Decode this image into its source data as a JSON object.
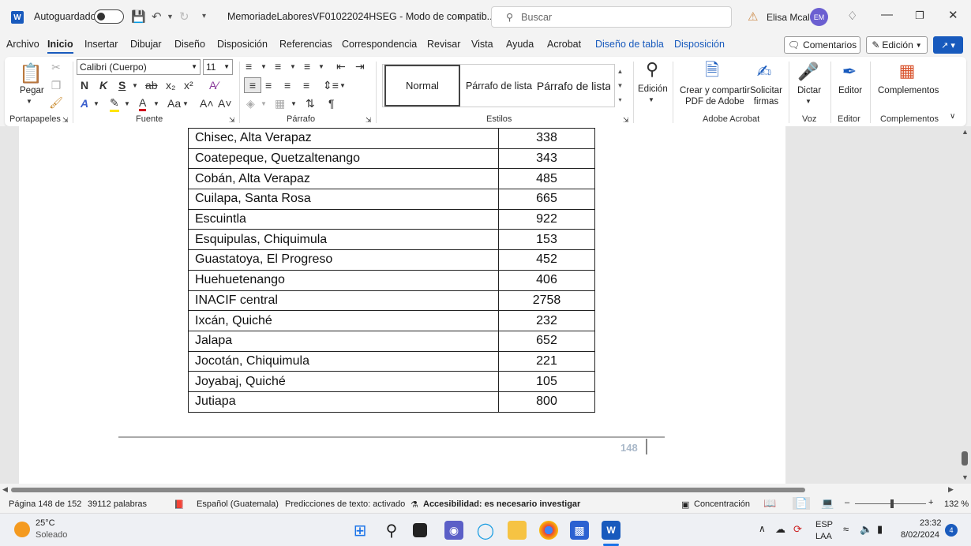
{
  "titlebar": {
    "autosave_label": "Autoguardado",
    "doc_title": "MemoriadeLaboresVF01022024HSEG  -  Modo de compatib...",
    "search_placeholder": "Buscar",
    "user_name": "Elisa Mcal",
    "user_initials": "EM"
  },
  "tabs": [
    "Archivo",
    "Inicio",
    "Insertar",
    "Dibujar",
    "Diseño",
    "Disposición",
    "Referencias",
    "Correspondencia",
    "Revisar",
    "Vista",
    "Ayuda",
    "Acrobat",
    "Diseño de tabla",
    "Disposición"
  ],
  "tab_actions": {
    "comments": "Comentarios",
    "editing": "Edición"
  },
  "ribbon": {
    "clipboard": {
      "paste": "Pegar",
      "label": "Portapapeles"
    },
    "font": {
      "family": "Calibri (Cuerpo)",
      "size": "11",
      "label": "Fuente",
      "bold": "N",
      "italic": "K",
      "underline": "S",
      "strike": "ab",
      "sub": "x₂",
      "sup": "x²",
      "case": "Aa"
    },
    "paragraph": {
      "label": "Párrafo"
    },
    "styles": {
      "label": "Estilos",
      "items": [
        "Normal",
        "Párrafo de lista",
        "Párrafo de lista"
      ]
    },
    "editing": {
      "label": "Edición"
    },
    "acrobat": {
      "create_share": "Crear y compartir\nPDF de Adobe",
      "request_sign": "Solicitar\nfirmas",
      "label": "Adobe Acrobat"
    },
    "voice": {
      "dictate": "Dictar",
      "label": "Voz"
    },
    "editor": {
      "editor": "Editor",
      "label": "Editor"
    },
    "addins": {
      "addins": "Complementos",
      "label": "Complementos"
    }
  },
  "document": {
    "rows": [
      {
        "name": "Chisec, Alta Verapaz",
        "value": "338"
      },
      {
        "name": "Coatepeque, Quetzaltenango",
        "value": "343"
      },
      {
        "name": "Cobán, Alta Verapaz",
        "value": "485"
      },
      {
        "name": "Cuilapa, Santa Rosa",
        "value": "665"
      },
      {
        "name": "Escuintla",
        "value": "922"
      },
      {
        "name": "Esquipulas, Chiquimula",
        "value": "153"
      },
      {
        "name": "Guastatoya, El Progreso",
        "value": "452"
      },
      {
        "name": "Huehuetenango",
        "value": "406"
      },
      {
        "name": "INACIF central",
        "value": "2758"
      },
      {
        "name": "Ixcán, Quiché",
        "value": "232"
      },
      {
        "name": "Jalapa",
        "value": "652"
      },
      {
        "name": "Jocotán, Chiquimula",
        "value": "221"
      },
      {
        "name": "Joyabaj, Quiché",
        "value": "105"
      },
      {
        "name": "Jutiapa",
        "value": "800"
      }
    ],
    "page_number": "148"
  },
  "statusbar": {
    "page": "Página 148 de 152",
    "words": "39112 palabras",
    "language": "Español (Guatemala)",
    "predictions": "Predicciones de texto: activado",
    "accessibility": "Accesibilidad: es necesario investigar",
    "focus": "Concentración",
    "zoom": "132 %"
  },
  "taskbar": {
    "temp": "25°C",
    "weather": "Soleado",
    "lang1": "ESP",
    "lang2": "LAA",
    "time": "23:32",
    "date": "8/02/2024",
    "notifications": "4"
  }
}
